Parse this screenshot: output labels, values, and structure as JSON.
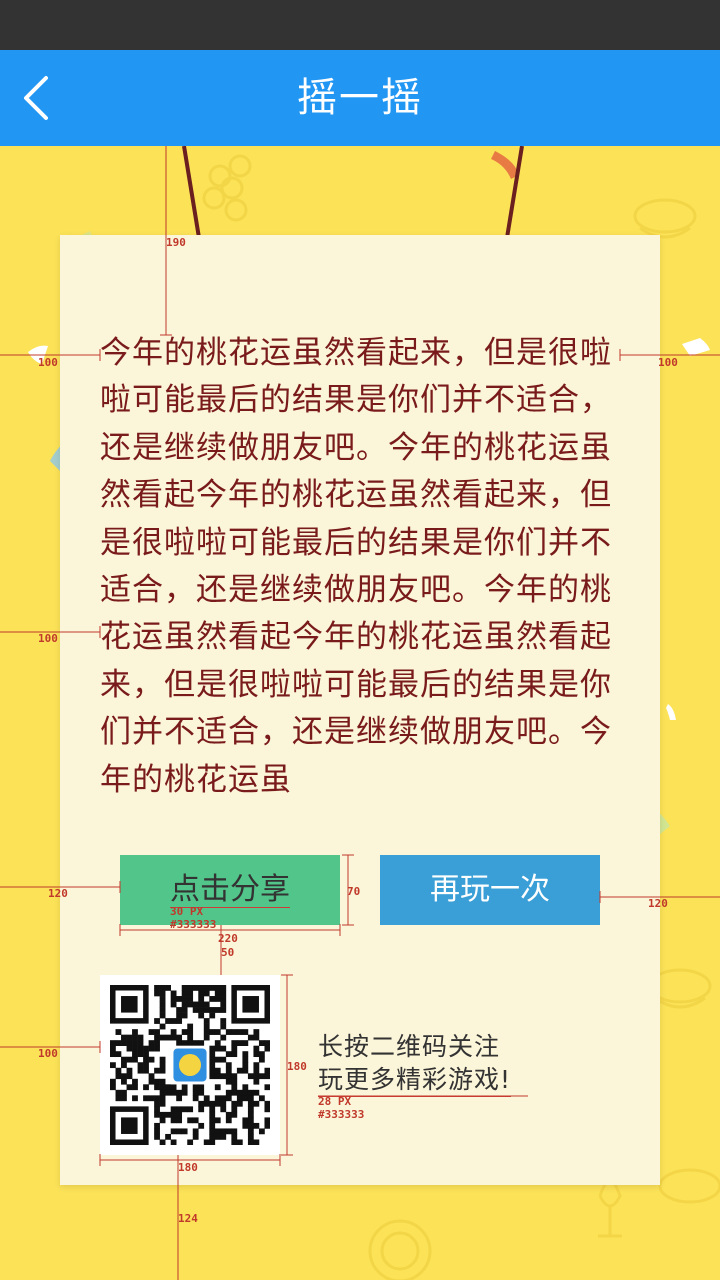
{
  "header": {
    "title": "摇一摇",
    "back_icon": "chevron-left-icon"
  },
  "message": "今年的桃花运虽然看起来，但是很啦啦可能最后的结果是你们并不适合，还是继续做朋友吧。今年的桃花运虽然看起今年的桃花运虽然看起来，但是很啦啦可能最后的结果是你们并不适合，还是继续做朋友吧。今年的桃花运虽然看起今年的桃花运虽然看起来，但是很啦啦可能最后的结果是你们并不适合，还是继续做朋友吧。今年的桃花运虽",
  "buttons": {
    "share_label": "点击分享",
    "replay_label": "再玩一次"
  },
  "qr": {
    "caption_line1": "长按二维码关注",
    "caption_line2": "玩更多精彩游戏!"
  },
  "annotations": {
    "hang": "190",
    "msg_left": "100",
    "msg_right": "100",
    "msg_left2": "100",
    "btn_left": "120",
    "btn_right": "120",
    "btn_height": "70",
    "btn_font": "30 PX",
    "btn_color": "#333333",
    "btn_width": "220",
    "btn_gap": "50",
    "qr_left": "100",
    "qr_height": "180",
    "qr_width": "180",
    "caption_font": "28 PX",
    "caption_color": "#333333",
    "bottom": "124"
  },
  "colors": {
    "status_bar": "#333333",
    "nav_bar": "#2196f3",
    "background": "#fbe257",
    "card": "#fbf5d9",
    "message_text": "#7a1b1b",
    "share_button": "#52c58a",
    "replay_button": "#3a9fd6",
    "annotation": "#c0392b"
  }
}
